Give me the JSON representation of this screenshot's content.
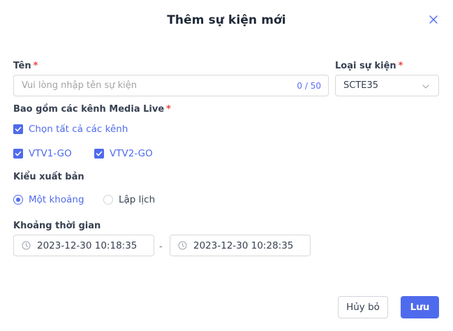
{
  "dialog": {
    "title": "Thêm sự kiện mới",
    "close_icon": "close-icon"
  },
  "form": {
    "name": {
      "label": "Tên",
      "required_mark": "*",
      "placeholder": "Vui lòng nhập tên sự kiện",
      "value": "",
      "counter": "0 / 50"
    },
    "event_type": {
      "label": "Loại sự kiện",
      "required_mark": "*",
      "selected": "SCTE35"
    },
    "channels": {
      "label": "Bao gồm các kênh Media Live",
      "required_mark": "*",
      "select_all": {
        "label": "Chọn tất cả các kênh",
        "checked": true
      },
      "items": [
        {
          "label": "VTV1-GO",
          "checked": true
        },
        {
          "label": "VTV2-GO",
          "checked": true
        }
      ]
    },
    "publish_type": {
      "label": "Kiểu xuất bản",
      "options": [
        {
          "label": "Một khoảng",
          "selected": true
        },
        {
          "label": "Lập lịch",
          "selected": false
        }
      ]
    },
    "time_range": {
      "label": "Khoảng thời gian",
      "start": "2023-12-30 10:18:35",
      "separator": "-",
      "end": "2023-12-30 10:28:35"
    }
  },
  "footer": {
    "cancel_label": "Hủy bỏ",
    "save_label": "Lưu"
  },
  "colors": {
    "accent": "#4f6bed",
    "required": "#ef4444",
    "border": "#d9d9d9"
  }
}
